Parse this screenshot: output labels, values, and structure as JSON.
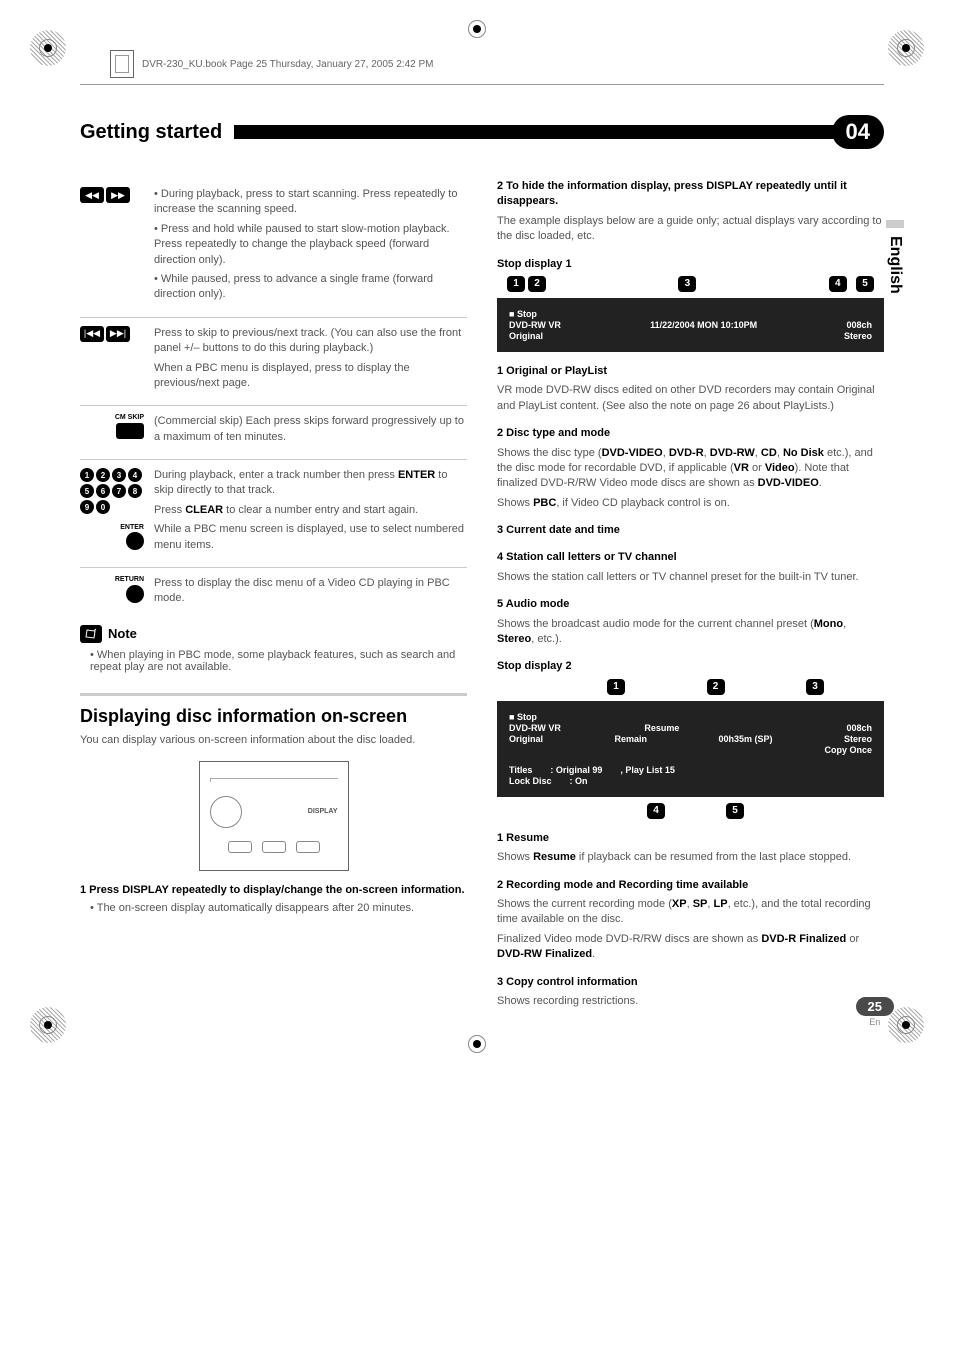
{
  "book_header": "DVR-230_KU.book  Page 25  Thursday, January 27, 2005  2:42 PM",
  "chapter_title": "Getting started",
  "chapter_num": "04",
  "side_tab": "English",
  "page_num": "25",
  "page_lang": "En",
  "left": {
    "row1": {
      "p1": "• During playback, press to start scanning. Press repeatedly to increase the scanning speed.",
      "p2": "• Press and hold while paused to start slow-motion playback. Press repeatedly to change the playback speed (forward direction only).",
      "p3": "• While paused, press to advance a single frame (forward direction only)."
    },
    "row2": {
      "p1": "Press to skip to previous/next track. (You can also use the front panel +/– buttons to do this during playback.)",
      "p2": "When a PBC menu is displayed, press to display the previous/next page."
    },
    "row3": {
      "label": "CM SKIP",
      "p1": "(Commercial skip) Each press skips forward progressively up to a maximum of ten minutes."
    },
    "row4": {
      "enter_label": "ENTER",
      "p1": "During playback, enter a track number then press ",
      "p1b": "ENTER",
      "p1c": " to skip directly to that track.",
      "p2a": "Press ",
      "p2b": "CLEAR",
      "p2c": " to clear a number entry and start again.",
      "p3": "While a PBC menu screen is displayed, use to select numbered menu items."
    },
    "row5": {
      "label": "RETURN",
      "p1": "Press to display the disc menu of a Video CD playing in PBC mode."
    },
    "note_title": "Note",
    "note_body": "When playing in PBC mode, some playback features, such as search and repeat play are not available.",
    "sect_title": "Displaying disc information on-screen",
    "sect_intro": "You can display various on-screen information about the disc loaded.",
    "remote_label": "DISPLAY",
    "step1_head": "1   Press DISPLAY repeatedly to display/change the on-screen information.",
    "step1_body": "The on-screen display automatically disappears after 20 minutes."
  },
  "right": {
    "step2_head": "2   To hide the information display, press DISPLAY repeatedly until it disappears.",
    "step2_body": "The example displays below are a guide only; actual displays vary according to the disc loaded, etc.",
    "stop1_title": "Stop display 1",
    "osd1": {
      "stop": "Stop",
      "line2a": "DVD-RW  VR",
      "line2b": "11/22/2004 MON 10:10PM",
      "line2c": "008ch",
      "line3a": "Original",
      "line3b": "Stereo"
    },
    "item1_head": "1    Original or PlayList",
    "item1_body": "VR mode DVD-RW discs edited on other DVD recorders may contain Original and PlayList content. (See also the note on page 26 about PlayLists.)",
    "item2_head": "2    Disc type and mode",
    "item2_body_a": "Shows the disc type (",
    "item2_body_b": "DVD-VIDEO",
    "item2_body_c": ", ",
    "item2_body_d": "DVD-R",
    "item2_body_e": ", ",
    "item2_body_f": "DVD-RW",
    "item2_body_g": ", ",
    "item2_body_h": "CD",
    "item2_body_i": ", ",
    "item2_body_j": "No Disk",
    "item2_body_k": " etc.), and the disc mode for recordable DVD, if applicable (",
    "item2_body_l": "VR",
    "item2_body_m": " or ",
    "item2_body_n": "Video",
    "item2_body_o": "). Note that finalized DVD-R/RW Video mode discs are shown as ",
    "item2_body_p": "DVD-VIDEO",
    "item2_body_q": ".",
    "item2_pbc_a": "Shows ",
    "item2_pbc_b": "PBC",
    "item2_pbc_c": ", if Video CD playback control is on.",
    "item3_head": "3    Current date and time",
    "item4_head": "4    Station call letters or TV channel",
    "item4_body": "Shows the station call letters or TV channel preset for the built-in TV tuner.",
    "item5_head": "5    Audio mode",
    "item5_body_a": "Shows the broadcast audio mode for the current channel preset (",
    "item5_body_b": "Mono",
    "item5_body_c": ", ",
    "item5_body_d": "Stereo",
    "item5_body_e": ", etc.).",
    "stop2_title": "Stop display 2",
    "osd2": {
      "stop": "Stop",
      "l2a": "DVD-RW  VR",
      "l2b": "Resume",
      "l2c": "008ch",
      "l3a": "Original",
      "l3b": "Remain",
      "l3c": "00h35m (SP)",
      "l3d": "Stereo",
      "l4": "Copy Once",
      "l5a": "Titles",
      "l5b": ": Original  99",
      "l5c": ", Play List  15",
      "l6a": "Lock Disc",
      "l6b": ":  On"
    },
    "s2_item1_head": "1    Resume",
    "s2_item1_a": "Shows ",
    "s2_item1_b": "Resume",
    "s2_item1_c": " if playback can be resumed from the last place stopped.",
    "s2_item2_head": "2    Recording mode and Recording time available",
    "s2_item2_a": "Shows the current recording mode (",
    "s2_item2_b": "XP",
    "s2_item2_c": ", ",
    "s2_item2_d": "SP",
    "s2_item2_e": ", ",
    "s2_item2_f": "LP",
    "s2_item2_g": ", etc.), and the total recording time available on the disc.",
    "s2_item2_fin_a": "Finalized Video mode DVD-R/RW discs are shown as ",
    "s2_item2_fin_b": "DVD-R Finalized",
    "s2_item2_fin_c": " or ",
    "s2_item2_fin_d": "DVD-RW Finalized",
    "s2_item2_fin_e": ".",
    "s2_item3_head": "3    Copy control information",
    "s2_item3_body": "Shows recording restrictions."
  }
}
